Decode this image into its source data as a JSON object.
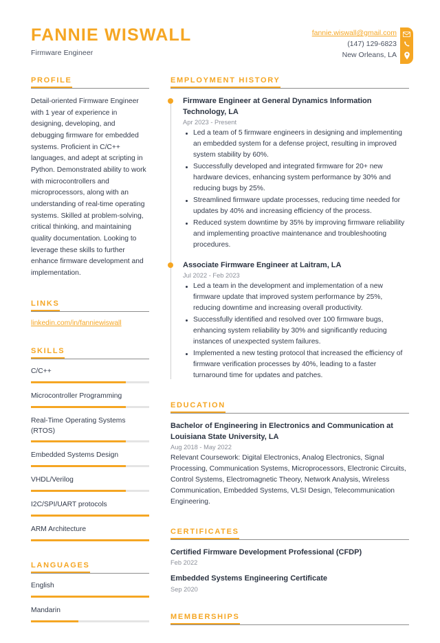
{
  "header": {
    "name": "FANNIE WISWALL",
    "job_title": "Firmware Engineer",
    "email": "fannie.wiswall@gmail.com",
    "phone": "(147) 129-6823",
    "location": "New Orleans, LA",
    "icons": [
      "envelope-icon",
      "phone-icon",
      "map-pin-icon"
    ]
  },
  "colors": {
    "accent": "#F5A623",
    "text": "#31394a",
    "muted": "#8b8f99",
    "rule": "#8c8c8c",
    "track": "#e4e4e4"
  },
  "sidebar": {
    "profile": {
      "title": "PROFILE",
      "text": "Detail-oriented Firmware Engineer with 1 year of experience in designing, developing, and debugging firmware for embedded systems. Proficient in C/C++ languages, and adept at scripting in Python. Demonstrated ability to work with microcontrollers and microprocessors, along with an understanding of real-time operating systems. Skilled at problem-solving, critical thinking, and maintaining quality documentation. Looking to leverage these skills to further enhance firmware development and implementation."
    },
    "links": {
      "title": "LINKS",
      "items": [
        {
          "label": "linkedin.com/in/fanniewiswall"
        }
      ]
    },
    "skills": {
      "title": "SKILLS",
      "items": [
        {
          "label": "C/C++",
          "level": 80
        },
        {
          "label": "Microcontroller Programming",
          "level": 80
        },
        {
          "label": "Real-Time Operating Systems (RTOS)",
          "level": 80
        },
        {
          "label": "Embedded Systems Design",
          "level": 80
        },
        {
          "label": "VHDL/Verilog",
          "level": 80
        },
        {
          "label": "I2C/SPI/UART protocols",
          "level": 100
        },
        {
          "label": "ARM Architecture",
          "level": 100
        }
      ]
    },
    "languages": {
      "title": "LANGUAGES",
      "items": [
        {
          "label": "English",
          "level": 100
        },
        {
          "label": "Mandarin",
          "level": 40
        }
      ]
    }
  },
  "main": {
    "employment": {
      "title": "EMPLOYMENT HISTORY",
      "jobs": [
        {
          "title": "Firmware Engineer at General Dynamics Information Technology, LA",
          "date": "Apr 2023 - Present",
          "bullets": [
            "Led a team of 5 firmware engineers in designing and implementing an embedded system for a defense project, resulting in improved system stability by 60%.",
            "Successfully developed and integrated firmware for 20+ new hardware devices, enhancing system performance by 30% and reducing bugs by 25%.",
            "Streamlined firmware update processes, reducing time needed for updates by 40% and increasing efficiency of the process.",
            "Reduced system downtime by 35% by improving firmware reliability and implementing proactive maintenance and troubleshooting procedures."
          ]
        },
        {
          "title": "Associate Firmware Engineer at Laitram, LA",
          "date": "Jul 2022 - Feb 2023",
          "bullets": [
            "Led a team in the development and implementation of a new firmware update that improved system performance by 25%, reducing downtime and increasing overall productivity.",
            "Successfully identified and resolved over 100 firmware bugs, enhancing system reliability by 30% and significantly reducing instances of unexpected system failures.",
            "Implemented a new testing protocol that increased the efficiency of firmware verification processes by 40%, leading to a faster turnaround time for updates and patches."
          ]
        }
      ]
    },
    "education": {
      "title": "EDUCATION",
      "entries": [
        {
          "title": "Bachelor of Engineering in Electronics and Communication at Louisiana State University, LA",
          "date": "Aug 2018 - May 2022",
          "description": "Relevant Coursework: Digital Electronics, Analog Electronics, Signal Processing, Communication Systems, Microprocessors, Electronic Circuits, Control Systems, Electromagnetic Theory, Network Analysis, Wireless Communication, Embedded Systems, VLSI Design, Telecommunication Engineering."
        }
      ]
    },
    "certificates": {
      "title": "CERTIFICATES",
      "entries": [
        {
          "title": "Certified Firmware Development Professional (CFDP)",
          "date": "Feb 2022"
        },
        {
          "title": "Embedded Systems Engineering Certificate",
          "date": "Sep 2020"
        }
      ]
    },
    "memberships": {
      "title": "MEMBERSHIPS"
    }
  }
}
